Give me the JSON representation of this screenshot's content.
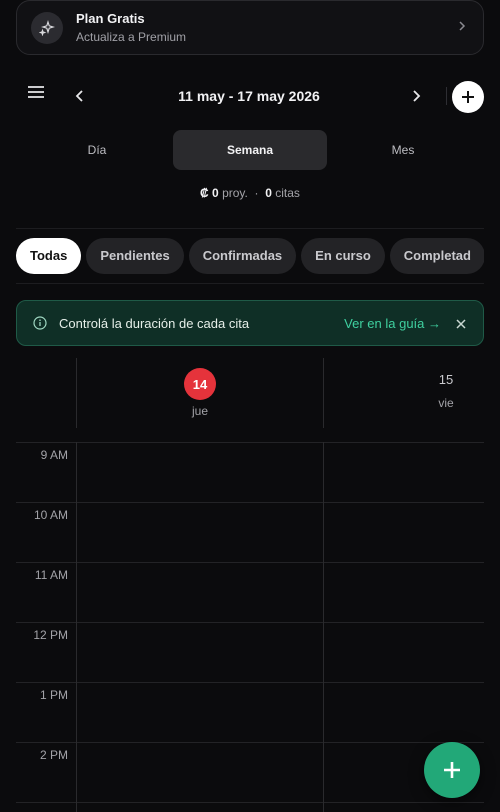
{
  "plan": {
    "title": "Plan Gratis",
    "subtitle": "Actualiza a Premium"
  },
  "header": {
    "range": "11 may - 17 may 2026"
  },
  "view_tabs": [
    {
      "label": "Día",
      "active": false
    },
    {
      "label": "Semana",
      "active": true
    },
    {
      "label": "Mes",
      "active": false
    }
  ],
  "summary": {
    "amount": "₡ 0",
    "amount_suffix": "proy.",
    "separator": "·",
    "count": "0",
    "count_suffix": "citas"
  },
  "filters": [
    {
      "label": "Todas",
      "active": true
    },
    {
      "label": "Pendientes",
      "active": false
    },
    {
      "label": "Confirmadas",
      "active": false
    },
    {
      "label": "En curso",
      "active": false
    },
    {
      "label": "Completad",
      "active": false
    }
  ],
  "tip": {
    "text": "Controlá la duración de cada cita",
    "link": "Ver en la guía →"
  },
  "calendar": {
    "days": [
      {
        "number": "14",
        "dow": "jue",
        "today": true
      },
      {
        "number": "15",
        "dow": "vie",
        "today": false
      }
    ],
    "hours": [
      "9 AM",
      "10 AM",
      "11 AM",
      "12 PM",
      "1 PM",
      "2 PM"
    ]
  },
  "colors": {
    "accent": "#22a878",
    "today": "#e5333b",
    "tip_bg": "#0f2f26",
    "tip_link": "#3fd1a0"
  }
}
